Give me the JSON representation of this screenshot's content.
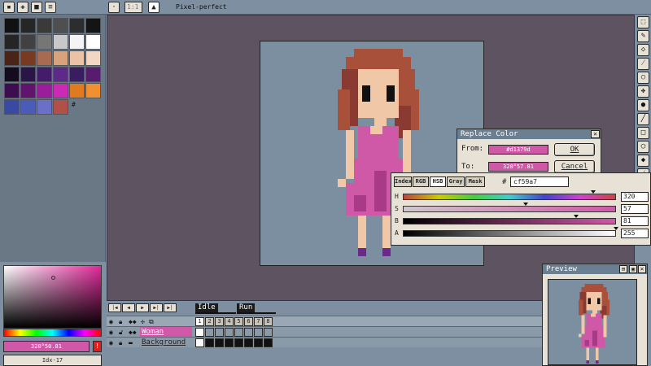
{
  "toolbar": {
    "zoom_value": "1:1",
    "pixel_perfect_label": "Pixel-perfect"
  },
  "palette": {
    "index_marker": "#",
    "colors": [
      [
        "#111111",
        "#262626",
        "#3a3a3a",
        "#4f4f4f",
        "#2d2d2d",
        "#141414"
      ],
      [
        "#252525",
        "#414141",
        "#767676",
        "#c8c8c8",
        "#f4f4f4",
        "#ffffff"
      ],
      [
        "#4a2416",
        "#7a3a22",
        "#a96a52",
        "#d7a27c",
        "#ebc2a6",
        "#f2d7c2"
      ],
      [
        "#140c1e",
        "#2a1646",
        "#441c6a",
        "#5d2a8a",
        "#3a1c60",
        "#581c6e"
      ],
      [
        "#3d0d50",
        "#60146e",
        "#9a1e9a",
        "#ca2ab4",
        "#e07a20",
        "#f09030"
      ],
      [
        "#3a4aa0",
        "#4a5cb8",
        "#6a70c8",
        "#b05048"
      ]
    ]
  },
  "color_bar": {
    "foreground_value": "320°50.81",
    "index_label": "Idx-17",
    "warning_symbol": "!"
  },
  "replace_color": {
    "title": "Replace Color",
    "from_label": "From:",
    "from_value": "#d1379d",
    "to_label": "To:",
    "to_value": "320°57.81",
    "ok_label": "OK",
    "cancel_label": "Cancel"
  },
  "color_popup": {
    "tabs": [
      "Index",
      "RGB",
      "HSB",
      "Gray",
      "Mask"
    ],
    "active_tab": "HSB",
    "hash": "#",
    "hex_value": "cf59a7",
    "channels": [
      {
        "label": "H",
        "value": "320",
        "level": 0.89
      },
      {
        "label": "S",
        "value": "57",
        "level": 0.57
      },
      {
        "label": "B",
        "value": "81",
        "level": 0.81
      },
      {
        "label": "A",
        "value": "255",
        "level": 1.0
      }
    ]
  },
  "timeline": {
    "tags": [
      "Idle",
      "Run"
    ],
    "frames": [
      "1",
      "2",
      "3",
      "4",
      "5",
      "6",
      "7",
      "8"
    ],
    "layers": [
      {
        "name": "Woman"
      },
      {
        "name": "Background"
      }
    ]
  },
  "preview": {
    "title": "Preview"
  },
  "sprite_colors": {
    "hair_dark": "#8a3a30",
    "hair": "#a9503a",
    "skin": "#f0c8a8",
    "dress": "#cf59a7",
    "dress_dark": "#a83a88",
    "shoes": "#6a2a8a",
    "outline": "#111111"
  }
}
